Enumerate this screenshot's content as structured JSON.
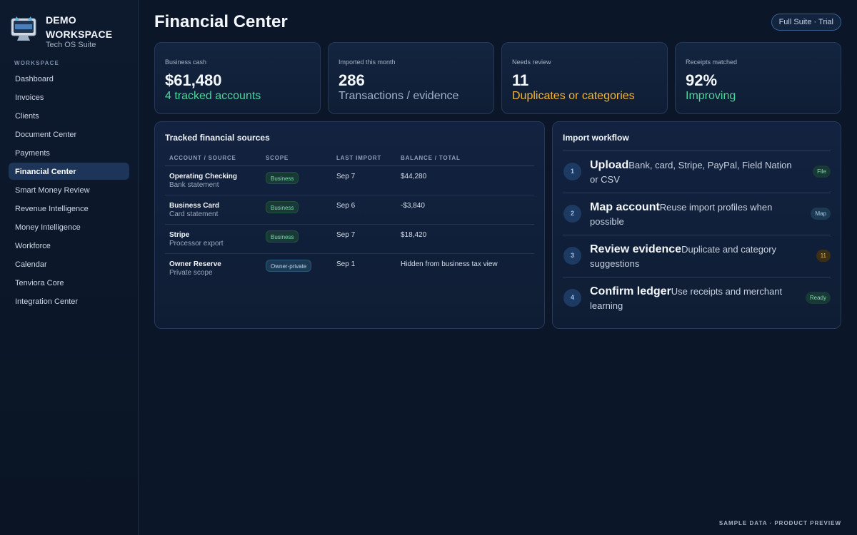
{
  "sidebar": {
    "brand_name": "DEMO WORKSPACE",
    "brand_sub": "Tech OS Suite",
    "logo_icon": "monitor-mascot-logo",
    "section_heading": "WORKSPACE",
    "items": [
      {
        "label": "Dashboard",
        "active": false
      },
      {
        "label": "Invoices",
        "active": false
      },
      {
        "label": "Clients",
        "active": false
      },
      {
        "label": "Document Center",
        "active": false
      },
      {
        "label": "Payments",
        "active": false
      },
      {
        "label": "Financial Center",
        "active": true
      },
      {
        "label": "Smart Money Review",
        "active": false
      },
      {
        "label": "Revenue Intelligence",
        "active": false
      },
      {
        "label": "Money Intelligence",
        "active": false
      },
      {
        "label": "Workforce",
        "active": false
      },
      {
        "label": "Calendar",
        "active": false
      },
      {
        "label": "Tenviora Core",
        "active": false
      },
      {
        "label": "Integration Center",
        "active": false
      }
    ]
  },
  "header": {
    "title": "Financial Center",
    "plan_badge": "Full Suite · Trial"
  },
  "stats": [
    {
      "label": "Business cash",
      "value": "$61,480",
      "sub": "4 tracked accounts",
      "sub_color": "#4fd39a"
    },
    {
      "label": "Imported this month",
      "value": "286",
      "sub": "Transactions / evidence",
      "sub_color": "#9fb0c7"
    },
    {
      "label": "Needs review",
      "value": "11",
      "sub": "Duplicates or categories",
      "sub_color": "#f2b636"
    },
    {
      "label": "Receipts matched",
      "value": "92%",
      "sub": "Improving",
      "sub_color": "#4fd39a"
    }
  ],
  "sources": {
    "title": "Tracked financial sources",
    "columns": [
      "ACCOUNT / SOURCE",
      "SCOPE",
      "LAST IMPORT",
      "BALANCE / TOTAL"
    ],
    "rows": [
      {
        "name": "Operating Checking",
        "sub": "Bank statement",
        "scope": "Business",
        "date": "Sep 7",
        "balance": "$44,280"
      },
      {
        "name": "Business Card",
        "sub": "Card statement",
        "scope": "Business",
        "date": "Sep 6",
        "balance": "-$3,840"
      },
      {
        "name": "Stripe",
        "sub": "Processor export",
        "scope": "Business",
        "date": "Sep 7",
        "balance": "$18,420"
      },
      {
        "name": "Owner Reserve",
        "sub": "Private scope",
        "scope": "Owner-private",
        "date": "Sep 1",
        "balance": "Hidden from business tax view"
      }
    ]
  },
  "workflow": {
    "title": "Import workflow",
    "steps": [
      {
        "num": "1",
        "title": "Upload",
        "desc": "Bank, card, Stripe, PayPal, Field Nation or CSV",
        "tag": "File"
      },
      {
        "num": "2",
        "title": "Map account",
        "desc": "Reuse import profiles when possible",
        "tag": "Map"
      },
      {
        "num": "3",
        "title": "Review evidence",
        "desc": "Duplicate and category suggestions",
        "tag": "11"
      },
      {
        "num": "4",
        "title": "Confirm ledger",
        "desc": "Use receipts and merchant learning",
        "tag": "Ready"
      }
    ]
  },
  "footer": "SAMPLE DATA · PRODUCT PREVIEW"
}
